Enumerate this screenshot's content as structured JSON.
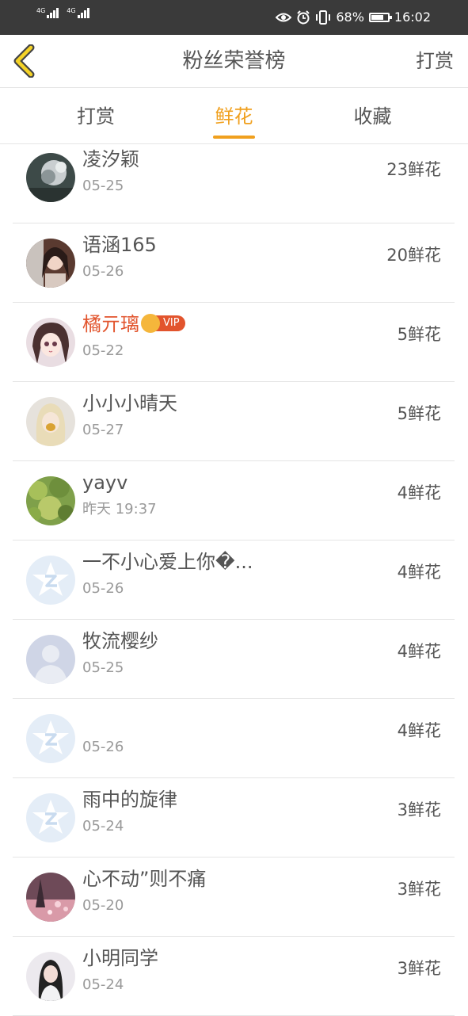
{
  "status_bar": {
    "signal1_label": "4G",
    "signal2_label": "4G",
    "battery_percent": "68%",
    "battery_level": 0.68,
    "time": "16:02",
    "icons": [
      "eye-icon",
      "alarm-icon",
      "vibrate-icon",
      "battery-icon"
    ]
  },
  "header": {
    "title": "粉丝荣誉榜",
    "right_action": "打赏",
    "back_icon": "chevron-left-icon",
    "accent_color": "#f0a01e"
  },
  "tabs": [
    {
      "label": "打赏",
      "active": false
    },
    {
      "label": "鲜花",
      "active": true
    },
    {
      "label": "收藏",
      "active": false
    }
  ],
  "fans": [
    {
      "name": "凌汐颖",
      "date": "05-25",
      "count": "23鲜花",
      "vip": false,
      "avatar": "photo-dark"
    },
    {
      "name": "语涵165",
      "date": "05-26",
      "count": "20鲜花",
      "vip": false,
      "avatar": "photo-girl"
    },
    {
      "name": "橘亓璃",
      "date": "05-22",
      "count": "5鲜花",
      "vip": true,
      "vip_label": "VIP",
      "avatar": "anime-girl"
    },
    {
      "name": "小小小晴天",
      "date": "05-27",
      "count": "5鲜花",
      "vip": false,
      "avatar": "photo-blonde"
    },
    {
      "name": "yayv",
      "date": "昨天 19:37",
      "count": "4鲜花",
      "vip": false,
      "avatar": "photo-green"
    },
    {
      "name": "一不小心爱上你�...",
      "date": "05-26",
      "count": "4鲜花",
      "vip": false,
      "avatar": "default-qzone"
    },
    {
      "name": "牧流樱纱",
      "date": "05-25",
      "count": "4鲜花",
      "vip": false,
      "avatar": "default-person"
    },
    {
      "name": "",
      "date": "05-26",
      "count": "4鲜花",
      "vip": false,
      "avatar": "default-qzone"
    },
    {
      "name": "雨中的旋律",
      "date": "05-24",
      "count": "3鲜花",
      "vip": false,
      "avatar": "default-qzone"
    },
    {
      "name": "心不动”则不痛",
      "date": "05-20",
      "count": "3鲜花",
      "vip": false,
      "avatar": "photo-night"
    },
    {
      "name": "小明同学",
      "date": "05-24",
      "count": "3鲜花",
      "vip": false,
      "avatar": "photo-portrait"
    }
  ]
}
